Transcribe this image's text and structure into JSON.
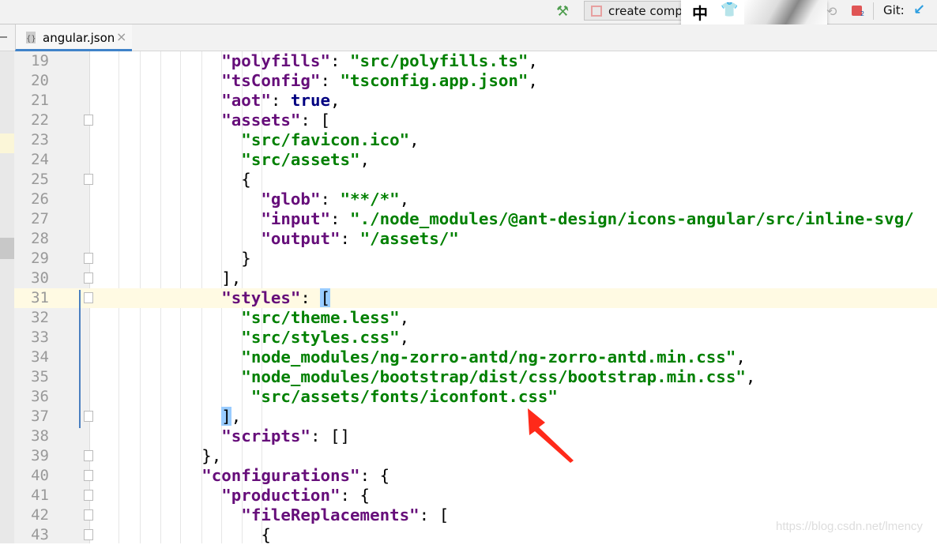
{
  "toolbar": {
    "run_config": "create comp",
    "ime_char": "中",
    "git_label": "Git:",
    "badge_count": "2"
  },
  "tab": {
    "filename": "angular.json",
    "close": "×",
    "file_icon": "{}"
  },
  "editor": {
    "current_line": 31,
    "lines": [
      {
        "n": "19",
        "fold": false,
        "tokens": [
          [
            "",
            "            "
          ],
          [
            "k",
            "\"polyfills\""
          ],
          [
            "",
            ": "
          ],
          [
            "s",
            "\"src/polyfills.ts\""
          ],
          [
            "",
            ","
          ]
        ]
      },
      {
        "n": "20",
        "fold": false,
        "tokens": [
          [
            "",
            "            "
          ],
          [
            "k",
            "\"tsConfig\""
          ],
          [
            "",
            ": "
          ],
          [
            "s",
            "\"tsconfig.app.json\""
          ],
          [
            "",
            ","
          ]
        ]
      },
      {
        "n": "21",
        "fold": false,
        "tokens": [
          [
            "",
            "            "
          ],
          [
            "k",
            "\"aot\""
          ],
          [
            "",
            ": "
          ],
          [
            "kw",
            "true"
          ],
          [
            "",
            ","
          ]
        ]
      },
      {
        "n": "22",
        "fold": true,
        "tokens": [
          [
            "",
            "            "
          ],
          [
            "k",
            "\"assets\""
          ],
          [
            "",
            ": ["
          ]
        ]
      },
      {
        "n": "23",
        "fold": false,
        "tokens": [
          [
            "",
            "              "
          ],
          [
            "s",
            "\"src/favicon.ico\""
          ],
          [
            "",
            ","
          ]
        ]
      },
      {
        "n": "24",
        "fold": false,
        "tokens": [
          [
            "",
            "              "
          ],
          [
            "s",
            "\"src/assets\""
          ],
          [
            "",
            ","
          ]
        ]
      },
      {
        "n": "25",
        "fold": true,
        "tokens": [
          [
            "",
            "              {"
          ]
        ]
      },
      {
        "n": "26",
        "fold": false,
        "tokens": [
          [
            "",
            "                "
          ],
          [
            "k",
            "\"glob\""
          ],
          [
            "",
            ": "
          ],
          [
            "s",
            "\"**/*\""
          ],
          [
            "",
            ","
          ]
        ]
      },
      {
        "n": "27",
        "fold": false,
        "tokens": [
          [
            "",
            "                "
          ],
          [
            "k",
            "\"input\""
          ],
          [
            "",
            ": "
          ],
          [
            "s",
            "\"./node_modules/@ant-design/icons-angular/src/inline-svg/"
          ]
        ]
      },
      {
        "n": "28",
        "fold": false,
        "tokens": [
          [
            "",
            "                "
          ],
          [
            "k",
            "\"output\""
          ],
          [
            "",
            ": "
          ],
          [
            "s",
            "\"/assets/\""
          ]
        ]
      },
      {
        "n": "29",
        "fold": true,
        "tokens": [
          [
            "",
            "              }"
          ]
        ]
      },
      {
        "n": "30",
        "fold": true,
        "tokens": [
          [
            "",
            "            ],"
          ]
        ]
      },
      {
        "n": "31",
        "fold": true,
        "tokens": [
          [
            "",
            "            "
          ],
          [
            "k",
            "\"styles\""
          ],
          [
            "",
            ": "
          ],
          [
            "hl",
            "["
          ]
        ]
      },
      {
        "n": "32",
        "fold": false,
        "tokens": [
          [
            "",
            "              "
          ],
          [
            "s",
            "\"src/theme.less\""
          ],
          [
            "",
            ","
          ]
        ]
      },
      {
        "n": "33",
        "fold": false,
        "tokens": [
          [
            "",
            "              "
          ],
          [
            "s",
            "\"src/styles.css\""
          ],
          [
            "",
            ","
          ]
        ]
      },
      {
        "n": "34",
        "fold": false,
        "tokens": [
          [
            "",
            "              "
          ],
          [
            "s",
            "\"node_modules/ng-zorro-antd/ng-zorro-antd.min.css\""
          ],
          [
            "",
            ","
          ]
        ]
      },
      {
        "n": "35",
        "fold": false,
        "tokens": [
          [
            "",
            "              "
          ],
          [
            "s",
            "\"node_modules/bootstrap/dist/css/bootstrap.min.css\""
          ],
          [
            "",
            ","
          ]
        ]
      },
      {
        "n": "36",
        "fold": false,
        "tokens": [
          [
            "",
            "               "
          ],
          [
            "s",
            "\"src/assets/fonts/iconfont.css\""
          ]
        ]
      },
      {
        "n": "37",
        "fold": true,
        "tokens": [
          [
            "",
            "            "
          ],
          [
            "hl",
            "]"
          ],
          [
            "",
            ","
          ]
        ]
      },
      {
        "n": "38",
        "fold": false,
        "tokens": [
          [
            "",
            "            "
          ],
          [
            "k",
            "\"scripts\""
          ],
          [
            "",
            ": []"
          ]
        ]
      },
      {
        "n": "39",
        "fold": true,
        "tokens": [
          [
            "",
            "          },"
          ]
        ]
      },
      {
        "n": "40",
        "fold": true,
        "tokens": [
          [
            "",
            "          "
          ],
          [
            "k",
            "\"configurations\""
          ],
          [
            "",
            ": {"
          ]
        ]
      },
      {
        "n": "41",
        "fold": true,
        "tokens": [
          [
            "",
            "            "
          ],
          [
            "k",
            "\"production\""
          ],
          [
            "",
            ": {"
          ]
        ]
      },
      {
        "n": "42",
        "fold": true,
        "tokens": [
          [
            "",
            "              "
          ],
          [
            "k",
            "\"fileReplacements\""
          ],
          [
            "",
            ": ["
          ]
        ]
      },
      {
        "n": "43",
        "fold": true,
        "tokens": [
          [
            "",
            "                {"
          ]
        ]
      }
    ]
  },
  "annotation": {
    "arrow_color": "#ff2a1a"
  },
  "colors": {
    "key": "#660e7a",
    "string": "#008000",
    "keyword": "#000080",
    "current_line": "#fffae3",
    "bracket_match": "#99ccff"
  },
  "watermark": "https://blog.csdn.net/lmency"
}
